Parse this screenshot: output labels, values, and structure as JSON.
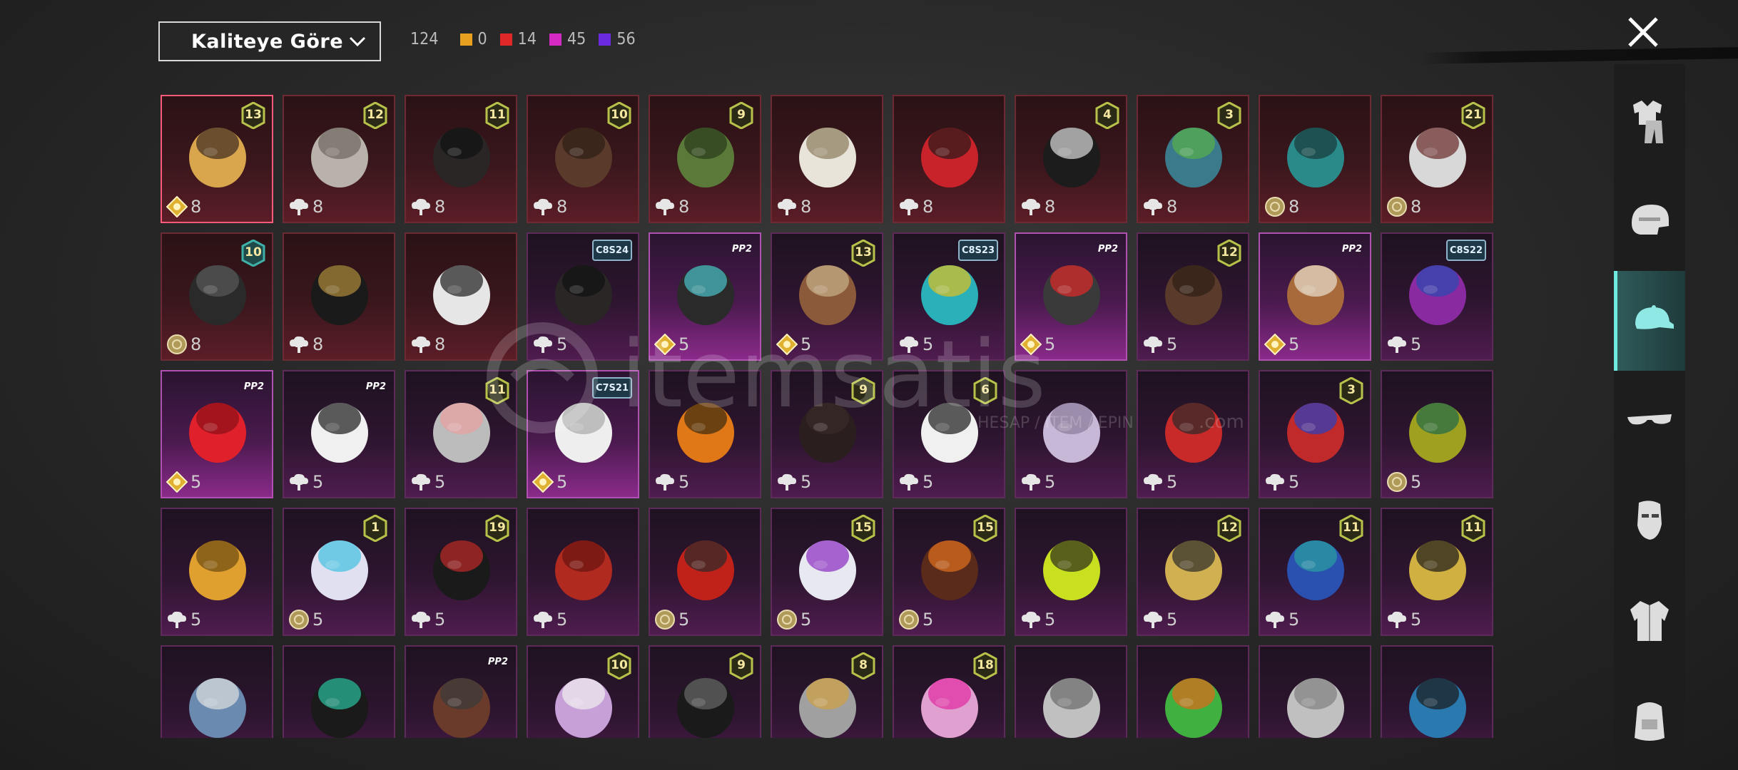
{
  "sort": {
    "label": "Kaliteye Göre"
  },
  "counts": {
    "total": "124",
    "items": [
      {
        "color": "#e8a020",
        "value": "0"
      },
      {
        "color": "#e02828",
        "value": "14"
      },
      {
        "color": "#d52bc4",
        "value": "45"
      },
      {
        "color": "#6b2ae0",
        "value": "56"
      }
    ]
  },
  "watermark": {
    "brand": "itemsatis",
    "sub": "HESAP / ITEM / EPIN",
    "tld": ".com"
  },
  "sidebar": [
    "outfit-tab",
    "helmet-tab",
    "hat-tab",
    "glasses-tab",
    "mask-tab",
    "jacket-tab",
    "backpack-tab"
  ],
  "rows": [
    [
      {
        "bg": "red",
        "badge": "13",
        "cost": "8",
        "coin": "gold",
        "art": "hat-blonde",
        "sel": true
      },
      {
        "bg": "red",
        "badge": "12",
        "cost": "8",
        "coin": "cloud",
        "art": "hair-grey"
      },
      {
        "bg": "red",
        "badge": "11",
        "cost": "8",
        "coin": "cloud",
        "art": "hair-black"
      },
      {
        "bg": "red",
        "badge": "10",
        "cost": "8",
        "coin": "cloud",
        "art": "hair-brown"
      },
      {
        "bg": "red",
        "badge": "9",
        "cost": "8",
        "coin": "cloud",
        "art": "zombie"
      },
      {
        "bg": "red",
        "badge": "",
        "cost": "8",
        "coin": "cloud",
        "art": "cowboy"
      },
      {
        "bg": "red",
        "badge": "",
        "cost": "8",
        "coin": "cloud",
        "art": "helmet-red"
      },
      {
        "bg": "red",
        "badge": "4",
        "cost": "8",
        "coin": "cloud",
        "art": "tophat"
      },
      {
        "bg": "red",
        "badge": "3",
        "cost": "8",
        "coin": "cloud",
        "art": "joker-green"
      },
      {
        "bg": "red",
        "badge": "",
        "cost": "8",
        "coin": "silver",
        "art": "dragon"
      },
      {
        "bg": "red",
        "badge": "21",
        "cost": "8",
        "coin": "silver",
        "art": "clown-white"
      }
    ],
    [
      {
        "bg": "red",
        "badge": "10",
        "badgeColor": "teal",
        "cost": "8",
        "coin": "silver",
        "art": "plague"
      },
      {
        "bg": "red",
        "badge": "",
        "cost": "8",
        "coin": "cloud",
        "art": "pirate"
      },
      {
        "bg": "red",
        "badge": "",
        "cost": "8",
        "coin": "cloud",
        "art": "checker"
      },
      {
        "bg": "purple",
        "tag": "C8S24",
        "cost": "5",
        "coin": "cloud",
        "art": "hair-black"
      },
      {
        "bg": "bright",
        "tag": "PP2",
        "cost": "5",
        "coin": "gold",
        "art": "hair-teal"
      },
      {
        "bg": "purple",
        "badge": "13",
        "cost": "5",
        "coin": "gold",
        "art": "goggles"
      },
      {
        "bg": "purple",
        "tag": "C8S23",
        "cost": "5",
        "coin": "cloud",
        "art": "cat-headset"
      },
      {
        "bg": "bright",
        "tag": "PP2",
        "cost": "5",
        "coin": "gold",
        "art": "cap-red"
      },
      {
        "bg": "purple",
        "badge": "12",
        "cost": "5",
        "coin": "cloud",
        "art": "hair-brown"
      },
      {
        "bg": "bright",
        "tag": "PP2",
        "cost": "5",
        "coin": "gold",
        "art": "dog"
      },
      {
        "bg": "purple",
        "tag": "C8S22",
        "cost": "5",
        "coin": "cloud",
        "art": "hair-purple"
      }
    ],
    [
      {
        "bg": "bright",
        "tag": "PP2",
        "cost": "5",
        "coin": "gold",
        "art": "hair-red"
      },
      {
        "bg": "purple",
        "tag": "PP2",
        "cost": "5",
        "coin": "cloud",
        "art": "panda"
      },
      {
        "bg": "purple",
        "badge": "11",
        "cost": "5",
        "coin": "cloud",
        "art": "veil"
      },
      {
        "bg": "bright",
        "tag": "C7S21",
        "cost": "5",
        "coin": "gold",
        "art": "hair-white"
      },
      {
        "bg": "purple",
        "badge": "",
        "cost": "5",
        "coin": "cloud",
        "art": "pumpkin"
      },
      {
        "bg": "purple",
        "badge": "9",
        "cost": "5",
        "coin": "cloud",
        "art": "hair-dark"
      },
      {
        "bg": "purple",
        "badge": "6",
        "cost": "5",
        "coin": "cloud",
        "art": "mask-bw"
      },
      {
        "bg": "purple",
        "badge": "",
        "cost": "5",
        "coin": "cloud",
        "art": "hair-lilac"
      },
      {
        "bg": "purple",
        "badge": "",
        "cost": "5",
        "coin": "cloud",
        "art": "oni"
      },
      {
        "bg": "purple",
        "badge": "3",
        "cost": "5",
        "coin": "cloud",
        "art": "jester"
      },
      {
        "bg": "purple",
        "badge": "",
        "cost": "5",
        "coin": "silver",
        "art": "feathers"
      }
    ],
    [
      {
        "bg": "purple",
        "badge": "",
        "cost": "5",
        "coin": "cloud",
        "art": "potato"
      },
      {
        "bg": "purple",
        "badge": "1",
        "cost": "5",
        "coin": "silver",
        "art": "pigtails"
      },
      {
        "bg": "purple",
        "badge": "19",
        "cost": "5",
        "coin": "cloud",
        "art": "hair-bun"
      },
      {
        "bg": "purple",
        "badge": "",
        "cost": "5",
        "coin": "cloud",
        "art": "hair-redtails"
      },
      {
        "bg": "purple",
        "badge": "",
        "cost": "5",
        "coin": "silver",
        "art": "headset-red"
      },
      {
        "bg": "purple",
        "badge": "15",
        "cost": "5",
        "coin": "silver",
        "art": "bird"
      },
      {
        "bg": "purple",
        "badge": "15",
        "cost": "5",
        "coin": "silver",
        "art": "spiky"
      },
      {
        "bg": "purple",
        "badge": "",
        "cost": "5",
        "coin": "cloud",
        "art": "buckethat"
      },
      {
        "bg": "purple",
        "badge": "12",
        "cost": "5",
        "coin": "cloud",
        "art": "can"
      },
      {
        "bg": "purple",
        "badge": "11",
        "cost": "5",
        "coin": "cloud",
        "art": "cap-blue"
      },
      {
        "bg": "purple",
        "badge": "11",
        "cost": "5",
        "coin": "cloud",
        "art": "arch"
      }
    ],
    [
      {
        "bg": "purple",
        "badge": "",
        "cost": "",
        "coin": "none",
        "art": "shark"
      },
      {
        "bg": "purple",
        "badge": "",
        "cost": "",
        "coin": "none",
        "art": "demon"
      },
      {
        "bg": "purple",
        "tag": "PP2",
        "cost": "",
        "coin": "none",
        "art": "gasmask"
      },
      {
        "bg": "purple",
        "badge": "10",
        "cost": "",
        "coin": "none",
        "art": "visor"
      },
      {
        "bg": "purple",
        "badge": "9",
        "cost": "",
        "coin": "none",
        "art": "helmet-black"
      },
      {
        "bg": "purple",
        "badge": "8",
        "cost": "",
        "coin": "none",
        "art": "robot"
      },
      {
        "bg": "purple",
        "badge": "18",
        "cost": "",
        "coin": "none",
        "art": "cap-pink"
      },
      {
        "bg": "purple",
        "badge": "",
        "cost": "",
        "coin": "none",
        "art": "dreads"
      },
      {
        "bg": "purple",
        "badge": "",
        "cost": "",
        "coin": "none",
        "art": "frog"
      },
      {
        "bg": "purple",
        "badge": "",
        "cost": "",
        "coin": "none",
        "art": "hair-silver"
      },
      {
        "bg": "purple",
        "badge": "",
        "cost": "",
        "coin": "none",
        "art": "helmet-blue"
      }
    ]
  ]
}
